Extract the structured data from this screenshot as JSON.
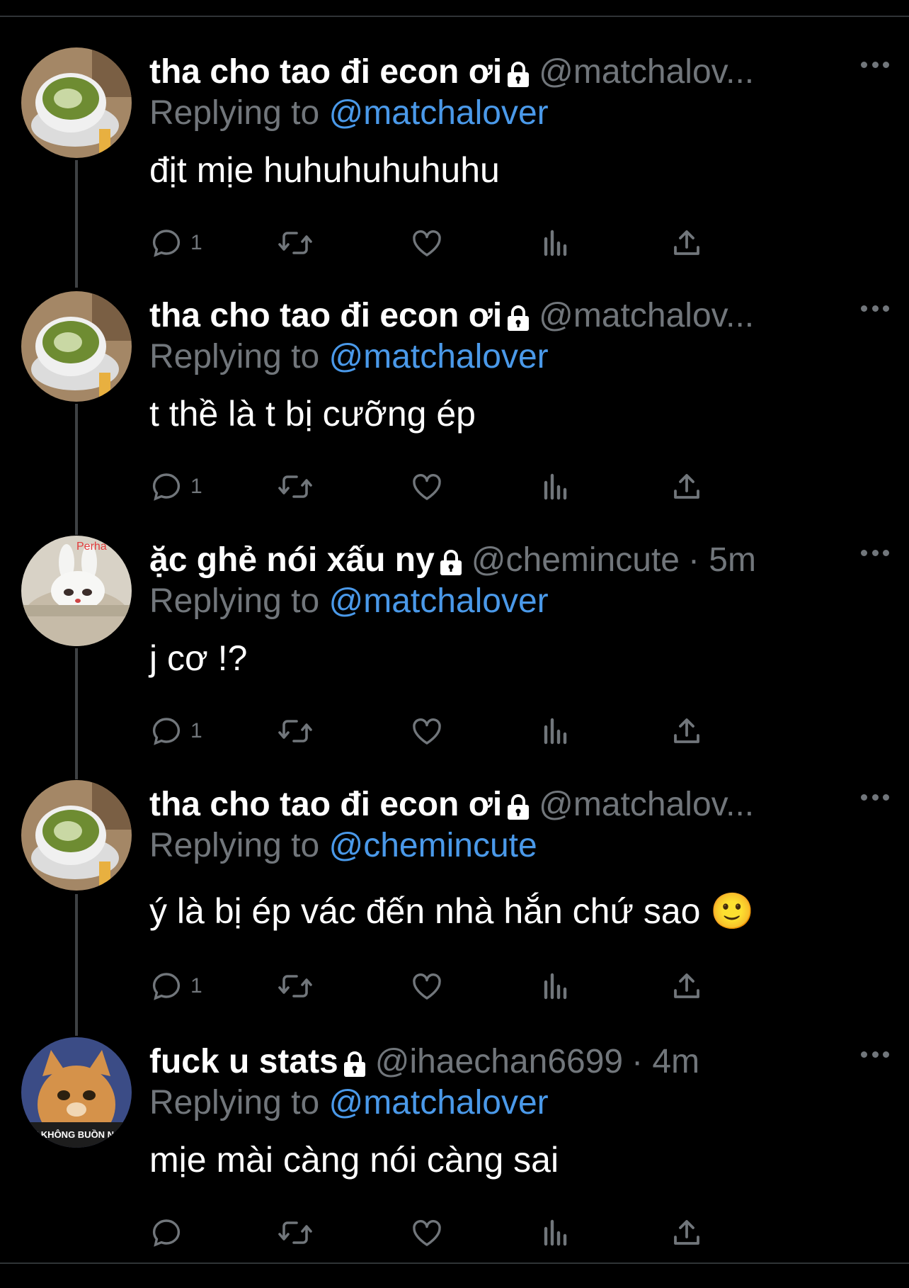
{
  "tweets": [
    {
      "display_name": "tha cho tao đi econ ơi",
      "handle": "@matchalov...",
      "time": "",
      "replying_prefix": "Replying to ",
      "replying_to": "@matchalover",
      "text": "địt mịe huhuhuhuhuhu",
      "reply_count": "1",
      "avatar": "matcha-latte"
    },
    {
      "display_name": "tha cho tao đi econ ơi",
      "handle": "@matchalov...",
      "time": "",
      "replying_prefix": "Replying to ",
      "replying_to": "@matchalover",
      "text": "t thề là t bị cưỡng ép",
      "reply_count": "1",
      "avatar": "matcha-latte"
    },
    {
      "display_name": "ặc ghẻ nói xấu ny",
      "handle": "@chemincute",
      "time": "· 5m",
      "replying_prefix": "Replying to ",
      "replying_to": "@matchalover",
      "text": "j cơ !?",
      "reply_count": "1",
      "avatar": "bunny-plush"
    },
    {
      "display_name": "tha cho tao đi econ ơi",
      "handle": "@matchalov...",
      "time": "",
      "replying_prefix": "Replying to ",
      "replying_to": "@chemincute",
      "text": "ý là bị ép vác đến nhà hắn chứ sao 🙂",
      "reply_count": "1",
      "avatar": "matcha-latte"
    },
    {
      "display_name": "fuck u stats",
      "handle": "@ihaechan6699",
      "time": "· 4m",
      "replying_prefix": "Replying to ",
      "replying_to": "@matchalover",
      "text": "mịe mài càng nói càng sai",
      "reply_count": "",
      "avatar": "grumpy-cat"
    }
  ],
  "avatar_texts": {
    "bunny": "Perha",
    "cat": "AU KHÔNG BUỒN NGỦ"
  },
  "icons": [
    "reply-icon",
    "retweet-icon",
    "like-icon",
    "views-icon",
    "share-icon",
    "lock-icon",
    "more-icon"
  ],
  "colors": {
    "background": "#000000",
    "text": "#ffffff",
    "secondary": "#71767b",
    "mention": "#4a99e9",
    "thread_line": "#3e4144"
  }
}
